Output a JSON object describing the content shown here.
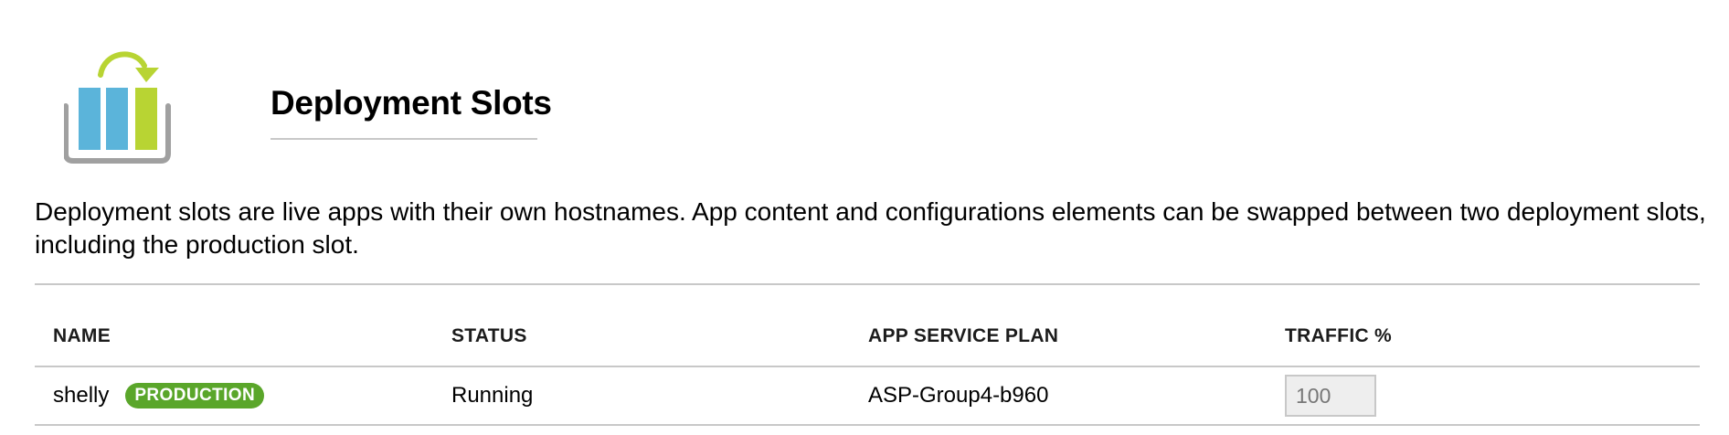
{
  "header": {
    "title": "Deployment Slots",
    "icon": "deployment-slots-swap-icon"
  },
  "description": "Deployment slots are live apps with their own hostnames. App content and configurations elements can be swapped between two deployment slots, including the production slot.",
  "colors": {
    "blue_bar": "#5bb4da",
    "green_bar": "#b8d433",
    "tray_gray": "#a0a0a0",
    "badge_green": "#5aa62a"
  },
  "table": {
    "columns": [
      "NAME",
      "STATUS",
      "APP SERVICE PLAN",
      "TRAFFIC %"
    ],
    "rows": [
      {
        "name": "shelly",
        "badge": "PRODUCTION",
        "status": "Running",
        "app_service_plan": "ASP-Group4-b960",
        "traffic": "100"
      }
    ]
  }
}
